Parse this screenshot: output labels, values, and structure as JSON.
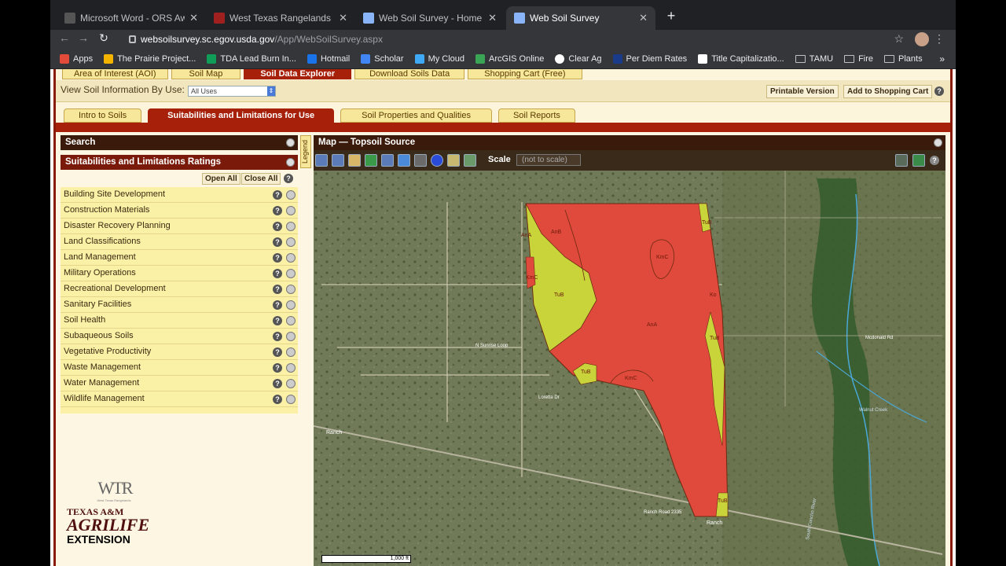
{
  "browser": {
    "tabs": [
      {
        "title": "Microsoft Word - ORS Award N",
        "active": false
      },
      {
        "title": "West Texas Rangelands | We h",
        "active": false
      },
      {
        "title": "Web Soil Survey - Home",
        "active": false
      },
      {
        "title": "Web Soil Survey",
        "active": true
      }
    ],
    "url_domain": "websoilsurvey.sc.egov.usda.gov",
    "url_path": "/App/WebSoilSurvey.aspx",
    "bookmarks": [
      "Apps",
      "The Prairie Project...",
      "TDA Lead Burn In...",
      "Hotmail",
      "Scholar",
      "My Cloud",
      "ArcGIS Online",
      "Clear Ag",
      "Per Diem Rates",
      "Title Capitalizatio...",
      "TAMU",
      "Fire",
      "Plants"
    ],
    "bookmarks_more": "»"
  },
  "wss": {
    "top_tabs": [
      "Area of Interest (AOI)",
      "Soil Map",
      "Soil Data Explorer",
      "Download Soils Data",
      "Shopping Cart (Free)"
    ],
    "view_label": "View Soil Information By Use:",
    "view_select": "All Uses",
    "printable": "Printable Version",
    "add_cart": "Add to Shopping Cart",
    "sub_tabs": [
      "Intro to Soils",
      "Suitabilities and Limitations for Use",
      "Soil Properties and Qualities",
      "Soil Reports"
    ],
    "search_title": "Search",
    "ratings_title": "Suitabilities and Limitations Ratings",
    "open_all": "Open All",
    "close_all": "Close All",
    "categories": [
      "Building Site Development",
      "Construction Materials",
      "Disaster Recovery Planning",
      "Land Classifications",
      "Land Management",
      "Military Operations",
      "Recreational Development",
      "Sanitary Facilities",
      "Soil Health",
      "Subaqueous Soils",
      "Vegetative Productivity",
      "Waste Management",
      "Water Management",
      "Wildlife Management"
    ],
    "legend_tab": "Legend",
    "logo_text": {
      "wtr": "WTR",
      "wtr_sub": "West Texas Rangelands",
      "l1": "TEXAS A&M",
      "l2": "AGRILIFE",
      "l3": "EXTENSION"
    },
    "map_title": "Map — Topsoil Source",
    "scale_label": "Scale",
    "scale_value": "(not to scale)",
    "scalebar": "1,000 ft",
    "map_labels": [
      "AnA",
      "AnB",
      "KmC",
      "KmC",
      "TuB",
      "AnA",
      "TuB",
      "KmC",
      "TuB",
      "TuB",
      "TuB",
      "Ko",
      "N Sunrise Loop",
      "Loretta Dr",
      "Ranch",
      "Ranch Road 2335",
      "Ranch",
      "Mcdonald Rd",
      "Walnut Creek",
      "South Concho River"
    ]
  },
  "colors": {
    "accent_red": "#a6200a",
    "tab_yellow": "#f7e79a",
    "poor_red": "#e04a3c",
    "fair_yellow": "#c8d43a"
  }
}
